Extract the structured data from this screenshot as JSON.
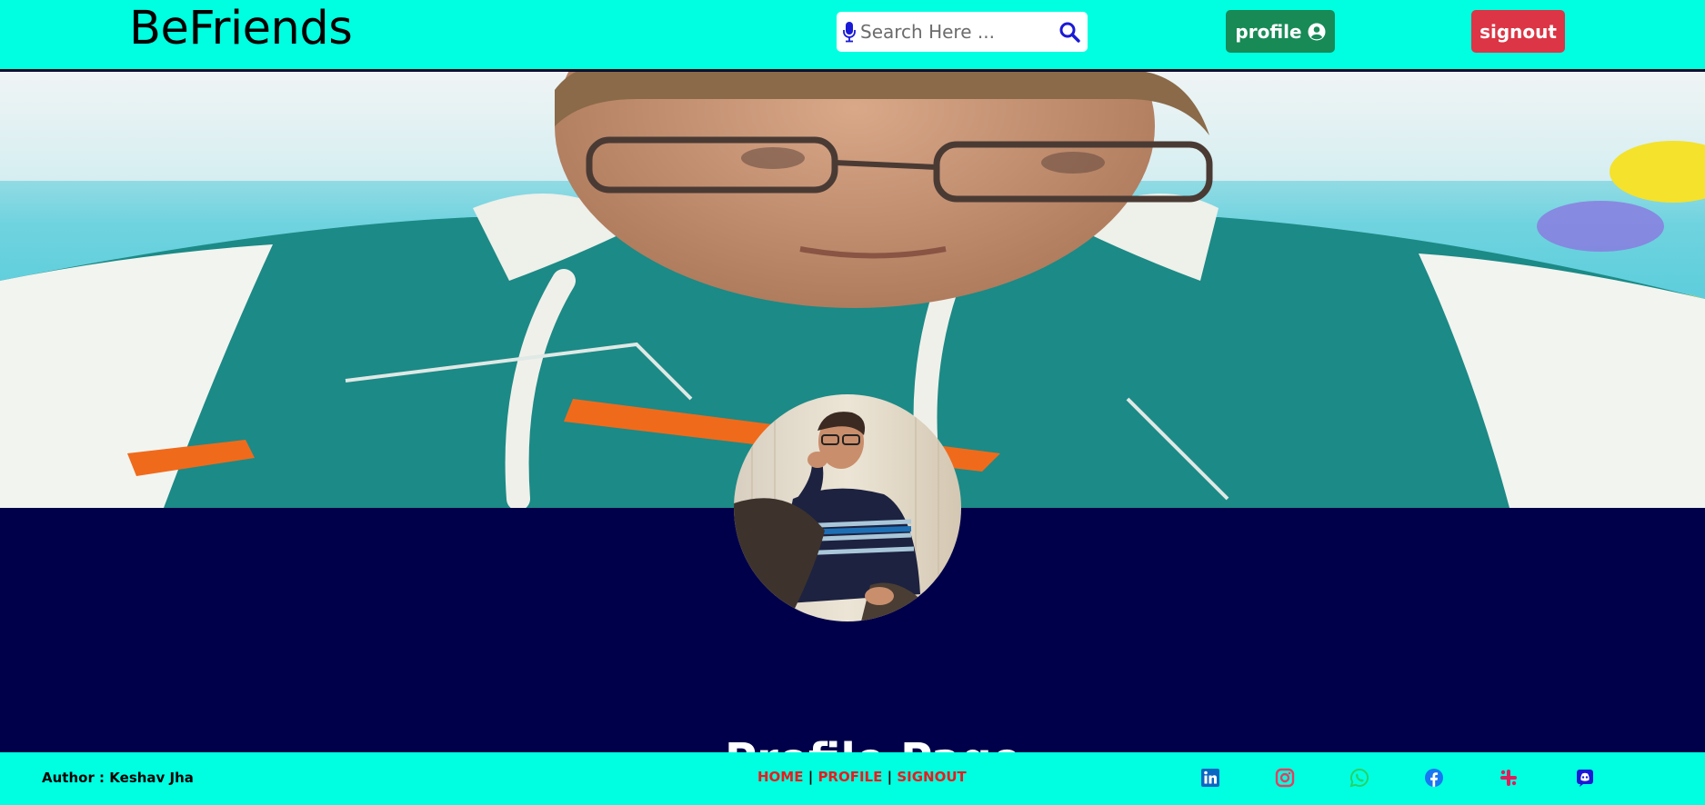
{
  "header": {
    "brand": "BeFriends",
    "search": {
      "placeholder": "Search Here ...",
      "value": ""
    },
    "profile_label": "profile",
    "signout_label": "signout"
  },
  "main": {
    "heading": "Profile Page"
  },
  "footer": {
    "author": "Author : Keshav Jha",
    "links": [
      "HOME",
      "PROFILE",
      "SIGNOUT"
    ],
    "separator": "|",
    "social": [
      "linkedin-icon",
      "instagram-icon",
      "whatsapp-icon",
      "facebook-icon",
      "slack-icon",
      "discord-icon"
    ]
  },
  "colors": {
    "header_bg": "#00ffe1",
    "page_bg": "#00004a",
    "profile_button": "#178a56",
    "signout_button": "#dc3545",
    "footer_link": "#e81c1c",
    "linkedin": "#0a66c2",
    "instagram": "#e4405f",
    "whatsapp": "#25d366",
    "facebook": "#1877f2",
    "slack": "#e01e5a",
    "discord": "#5865f2"
  }
}
